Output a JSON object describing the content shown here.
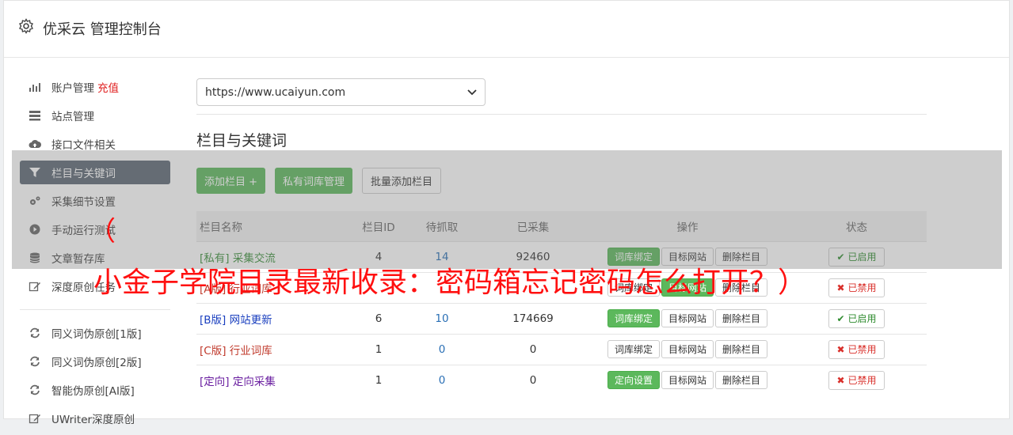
{
  "header": {
    "title": "优采云 管理控制台"
  },
  "sidebar": {
    "items": [
      {
        "label": "账户管理",
        "extra": "充值"
      },
      {
        "label": "站点管理"
      },
      {
        "label": "接口文件相关"
      },
      {
        "label": "栏目与关键词"
      },
      {
        "label": "采集细节设置"
      },
      {
        "label": "手动运行测试"
      },
      {
        "label": "文章暂存库"
      },
      {
        "label": "深度原创任务"
      },
      {
        "label": "同义词伪原创[1版]"
      },
      {
        "label": "同义词伪原创[2版]"
      },
      {
        "label": "智能伪原创[AI版]"
      },
      {
        "label": "UWriter深度原创"
      }
    ]
  },
  "main": {
    "site_select": "https://www.ucaiyun.com",
    "section_title": "栏目与关键词",
    "buttons": {
      "add": "添加栏目 +",
      "private": "私有词库管理",
      "batch": "批量添加栏目"
    },
    "table": {
      "headers": [
        "栏目名称",
        "栏目ID",
        "待抓取",
        "已采集",
        "操作",
        "状态"
      ],
      "rows": [
        {
          "tag": "[私有]",
          "name": "采集交流",
          "id": "4",
          "pending": "14",
          "collected": "92460",
          "op1": "词库绑定",
          "op2": "目标网站",
          "op3": "删除栏目",
          "status": "已启用"
        },
        {
          "tag": "[A版]",
          "name": "行业词库",
          "id": "",
          "pending": "",
          "collected": "",
          "op1": "词库绑定",
          "op2": "目标网站",
          "op3": "删除栏目",
          "status": "已禁用"
        },
        {
          "tag": "[B版]",
          "name": "网站更新",
          "id": "6",
          "pending": "10",
          "collected": "174669",
          "op1": "词库绑定",
          "op2": "目标网站",
          "op3": "删除栏目",
          "status": "已启用"
        },
        {
          "tag": "[C版]",
          "name": "行业词库",
          "id": "1",
          "pending": "0",
          "collected": "0",
          "op1": "词库绑定",
          "op2": "目标网站",
          "op3": "删除栏目",
          "status": "已禁用"
        },
        {
          "tag": "[定向]",
          "name": "定向采集",
          "id": "1",
          "pending": "0",
          "collected": "0",
          "op1": "定向设置",
          "op2": "目标网站",
          "op3": "删除栏目",
          "status": "已禁用"
        }
      ]
    }
  },
  "watermark": {
    "open_paren": "（",
    "text": "小金子学院目录最新收录：密码箱忘记密码怎么打开？）"
  }
}
